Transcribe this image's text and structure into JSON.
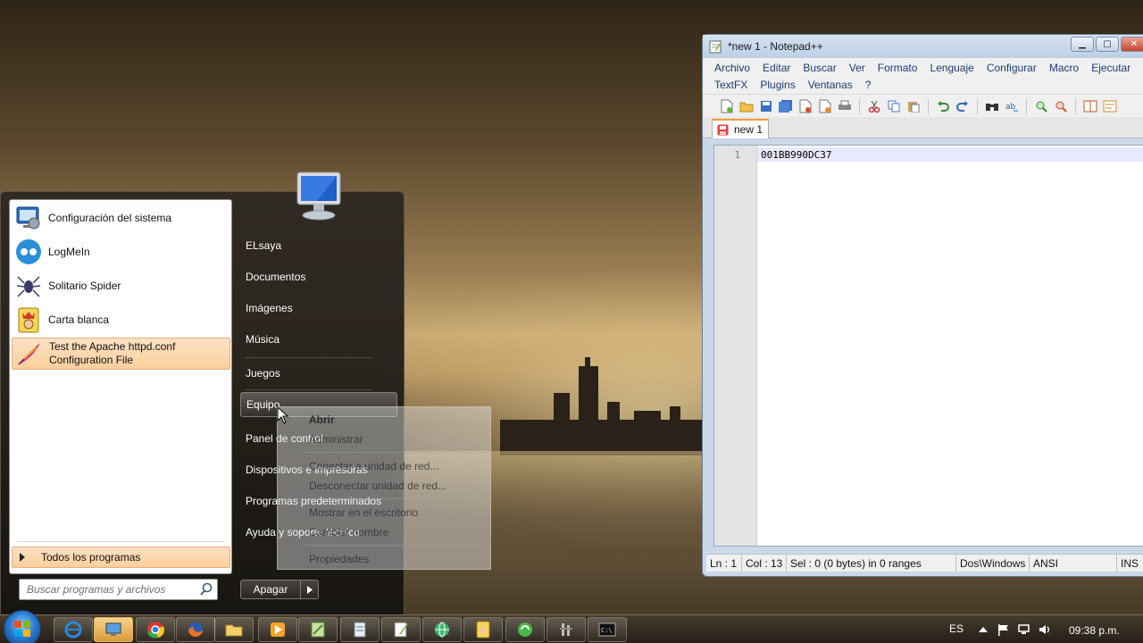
{
  "notepad": {
    "title": "*new  1 - Notepad++",
    "menu": [
      "Archivo",
      "Editar",
      "Buscar",
      "Ver",
      "Formato",
      "Lenguaje",
      "Configurar",
      "Macro",
      "Ejecutar",
      "TextFX",
      "Plugins",
      "Ventanas",
      "?"
    ],
    "tab_label": "new  1",
    "line_number": "1",
    "content": "001BB990DC37",
    "status": {
      "ln": "Ln : 1",
      "col": "Col : 13",
      "sel": "Sel : 0 (0 bytes) in 0 ranges",
      "eol": "Dos\\Windows",
      "encoding": "ANSI",
      "mode": "INS"
    }
  },
  "start_menu": {
    "programs": [
      {
        "label": "Configuración del sistema",
        "icon": "system-config-icon"
      },
      {
        "label": "LogMeIn",
        "icon": "logmein-icon"
      },
      {
        "label": "Solitario Spider",
        "icon": "spider-solitaire-icon"
      },
      {
        "label": "Carta blanca",
        "icon": "freecell-icon"
      },
      {
        "label": "Test the Apache httpd.conf Configuration File",
        "label_line1": "Test the Apache httpd.conf",
        "label_line2": "Configuration File",
        "icon": "apache-feather-icon"
      }
    ],
    "all_programs": "Todos los programas",
    "search_placeholder": "Buscar programas y archivos",
    "right_items": [
      "ELsaya",
      "Documentos",
      "Imágenes",
      "Música",
      "Juegos",
      "Equipo",
      "Panel de control",
      "Dispositivos e impresoras",
      "Programas predeterminados",
      "Ayuda y soporte técnico"
    ],
    "shutdown_label": "Apagar"
  },
  "context_menu": {
    "items": [
      "Abrir",
      "Administrar",
      "Conectar a unidad de red...",
      "Desconectar unidad de red...",
      "Mostrar en el escritorio",
      "Cambiar nombre",
      "Propiedades"
    ]
  },
  "taskbar": {
    "language": "ES",
    "clock": "09:38 p.m."
  },
  "colors": {
    "highlight": "#fbcf9d",
    "tab_accent": "#f39a34",
    "menu_text": "#1e3b70"
  }
}
